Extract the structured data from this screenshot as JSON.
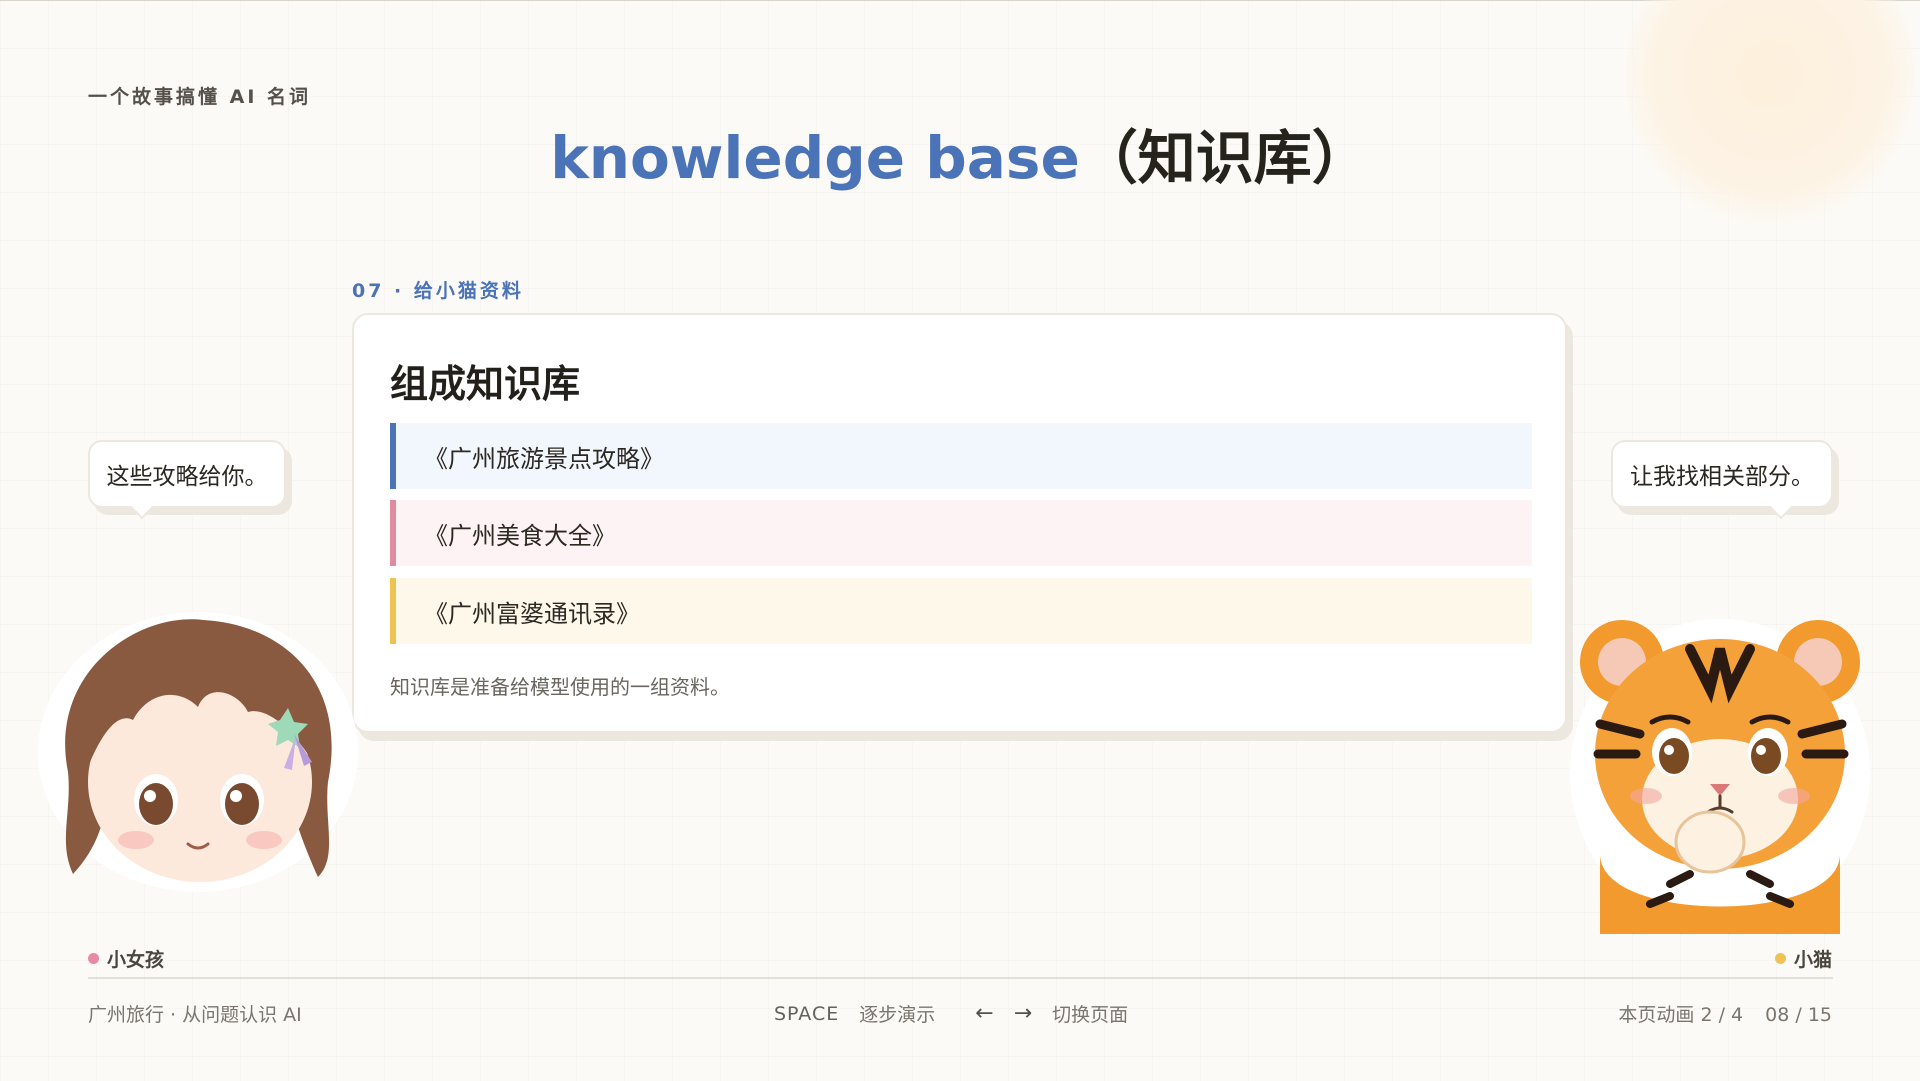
{
  "header": {
    "series_label": "一个故事搞懂 AI 名词",
    "title_en": "knowledge base",
    "title_cn": "（知识库）"
  },
  "section": {
    "label": "07 · 给小猫资料"
  },
  "card": {
    "title": "组成知识库",
    "items": [
      {
        "label": "《广州旅游景点攻略》",
        "accent": "#4a73b8"
      },
      {
        "label": "《广州美食大全》",
        "accent": "#e08ca0"
      },
      {
        "label": "《广州富婆通讯录》",
        "accent": "#eec354"
      }
    ],
    "note": "知识库是准备给模型使用的一组资料。"
  },
  "bubbles": {
    "left": "这些攻略给你。",
    "right": "让我找相关部分。"
  },
  "characters": {
    "left_name": "小女孩",
    "right_name": "小猫",
    "left_dot_color": "#e88aa3",
    "right_dot_color": "#eec354"
  },
  "footer": {
    "left": "广州旅行 · 从问题认识 AI",
    "space_key": "SPACE",
    "space_action": "逐步演示",
    "arrow_left": "←",
    "arrow_right": "→",
    "arrow_action": "切换页面",
    "animation": "本页动画 2 / 4",
    "page": "08 / 15"
  },
  "colors": {
    "accent_blue": "#4a73b8",
    "background": "#fcfaf6"
  }
}
